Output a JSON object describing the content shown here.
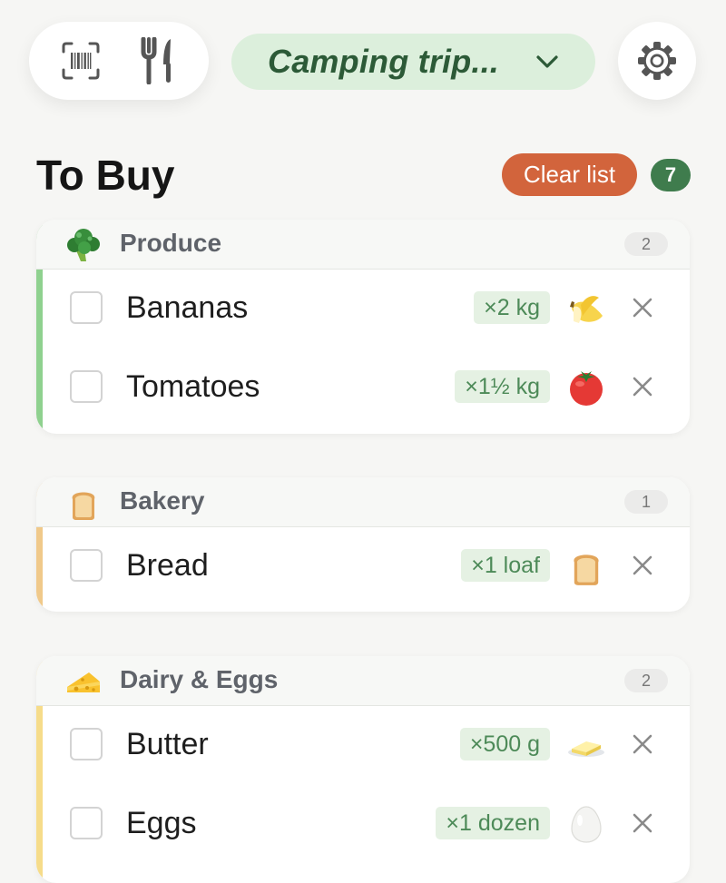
{
  "header": {
    "list_name": "Camping trip...",
    "icons": {
      "scan": "barcode-scan-icon",
      "recipes": "fork-knife-icon",
      "dropdown": "chevron-down-icon",
      "settings": "gear-icon"
    }
  },
  "title": "To Buy",
  "clear_label": "Clear list",
  "total_count": "7",
  "colors": {
    "accent_green": "#3f7c4d",
    "clear_button": "#d2643c",
    "produce_stripe": "#8fd18f",
    "bakery_stripe": "#f0c98a",
    "dairy_stripe": "#f6dc8a"
  },
  "sections": [
    {
      "name": "Produce",
      "count": "2",
      "icon": "broccoli-icon",
      "items": [
        {
          "name": "Bananas",
          "qty": "×2 kg",
          "icon": "banana-icon"
        },
        {
          "name": "Tomatoes",
          "qty": "×1½ kg",
          "icon": "tomato-icon"
        }
      ]
    },
    {
      "name": "Bakery",
      "count": "1",
      "icon": "bread-icon",
      "items": [
        {
          "name": "Bread",
          "qty": "×1 loaf",
          "icon": "bread-icon"
        }
      ]
    },
    {
      "name": "Dairy & Eggs",
      "count": "2",
      "icon": "cheese-icon",
      "items": [
        {
          "name": "Butter",
          "qty": "×500 g",
          "icon": "butter-icon"
        },
        {
          "name": "Eggs",
          "qty": "×1 dozen",
          "icon": "egg-icon"
        }
      ]
    }
  ]
}
